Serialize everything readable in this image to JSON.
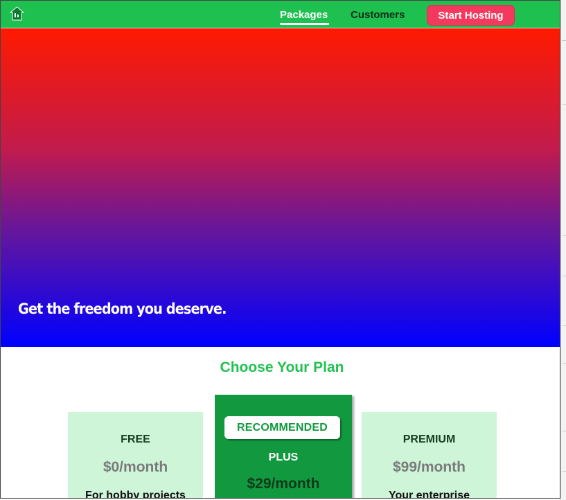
{
  "header": {
    "nav": {
      "packages_label": "Packages",
      "customers_label": "Customers"
    },
    "cta_label": "Start Hosting"
  },
  "hero": {
    "tagline": "Get the freedom you deserve."
  },
  "plans": {
    "heading": "Choose Your Plan",
    "cards": [
      {
        "title": "FREE",
        "price": "$0/month",
        "description": "For hobby projects"
      },
      {
        "badge": "RECOMMENDED",
        "title": "PLUS",
        "price": "$29/month"
      },
      {
        "title": "PREMIUM",
        "price": "$99/month",
        "description": "Your enterprise"
      }
    ]
  },
  "colors": {
    "header_bg": "#1ec04f",
    "cta_bg": "#f33a5e",
    "hero_gradient": [
      "#ff1a00",
      "#c11b4d",
      "#6a1797",
      "#0000ff"
    ],
    "accent_green": "#22c152",
    "recommended_card_bg": "#12993f",
    "card_bg": "#cef5d8"
  },
  "icons": {
    "logo": "house-logo-icon"
  }
}
